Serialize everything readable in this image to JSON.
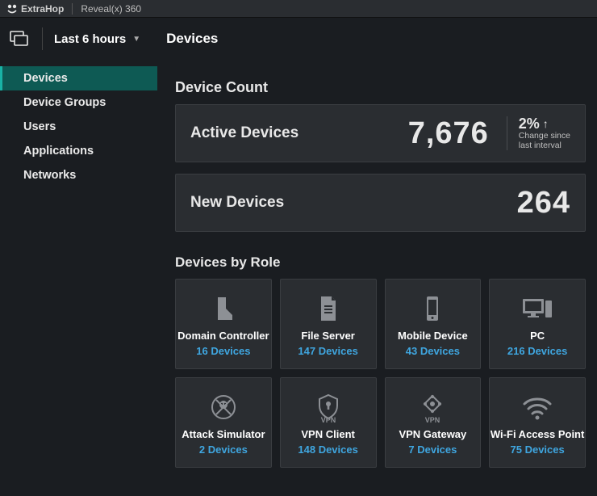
{
  "brand": {
    "name": "ExtraHop",
    "product": "Reveal(x)  360"
  },
  "controlbar": {
    "time_label": "Last 6 hours",
    "page_title": "Devices"
  },
  "sidebar": {
    "items": [
      {
        "label": "Devices",
        "active": true
      },
      {
        "label": "Device Groups",
        "active": false
      },
      {
        "label": "Users",
        "active": false
      },
      {
        "label": "Applications",
        "active": false
      },
      {
        "label": "Networks",
        "active": false
      }
    ]
  },
  "device_count": {
    "title": "Device Count",
    "active": {
      "label": "Active Devices",
      "value": "7,676",
      "change_pct": "2%",
      "change_dir": "up",
      "change_text1": "Change since",
      "change_text2": "last interval"
    },
    "new": {
      "label": "New Devices",
      "value": "264"
    }
  },
  "roles": {
    "title": "Devices by Role",
    "items": [
      {
        "name": "Domain Controller",
        "count": "16 Devices",
        "icon": "domain-controller"
      },
      {
        "name": "File Server",
        "count": "147 Devices",
        "icon": "file-server"
      },
      {
        "name": "Mobile Device",
        "count": "43 Devices",
        "icon": "mobile-device"
      },
      {
        "name": "PC",
        "count": "216 Devices",
        "icon": "pc"
      },
      {
        "name": "Attack Simulator",
        "count": "2 Devices",
        "icon": "attack-simulator"
      },
      {
        "name": "VPN Client",
        "count": "148 Devices",
        "icon": "vpn-client"
      },
      {
        "name": "VPN Gateway",
        "count": "7 Devices",
        "icon": "vpn-gateway"
      },
      {
        "name": "Wi-Fi Access Point",
        "count": "75 Devices",
        "icon": "wifi-ap"
      }
    ]
  }
}
